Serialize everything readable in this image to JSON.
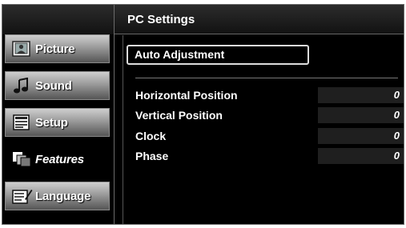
{
  "header": {
    "title": "PC Settings"
  },
  "menu": [
    {
      "label": "Picture",
      "icon": "picture-icon",
      "active": false
    },
    {
      "label": "Sound",
      "icon": "sound-icon",
      "active": false
    },
    {
      "label": "Setup",
      "icon": "setup-icon",
      "active": false
    },
    {
      "label": "Features",
      "icon": "features-icon",
      "active": true
    },
    {
      "label": "Language",
      "icon": "language-icon",
      "active": false
    }
  ],
  "auto_adjustment": {
    "label": "Auto Adjustment"
  },
  "settings": [
    {
      "label": "Horizontal Position",
      "value": "0"
    },
    {
      "label": "Vertical Position",
      "value": "0"
    },
    {
      "label": "Clock",
      "value": "0"
    },
    {
      "label": "Phase",
      "value": "0"
    }
  ]
}
